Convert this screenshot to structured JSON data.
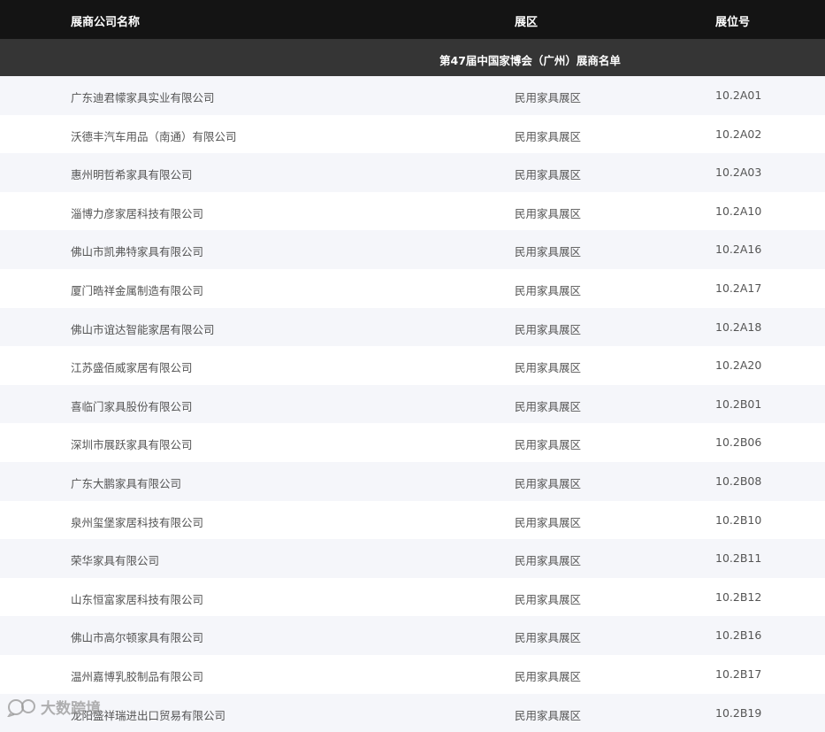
{
  "header": {
    "col_name": "展商公司名称",
    "col_zone": "展区",
    "col_booth": "展位号"
  },
  "subtitle": "第47届中国家博会（广州）展商名单",
  "rows": [
    {
      "name": "广东迪君幪家具实业有限公司",
      "zone": "民用家具展区",
      "booth": "10.2A01"
    },
    {
      "name": "沃德丰汽车用品（南通）有限公司",
      "zone": "民用家具展区",
      "booth": "10.2A02"
    },
    {
      "name": "惠州明哲希家具有限公司",
      "zone": "民用家具展区",
      "booth": "10.2A03"
    },
    {
      "name": "淄博力彦家居科技有限公司",
      "zone": "民用家具展区",
      "booth": "10.2A10"
    },
    {
      "name": "佛山市凯弗特家具有限公司",
      "zone": "民用家具展区",
      "booth": "10.2A16"
    },
    {
      "name": "厦门晧祥金属制造有限公司",
      "zone": "民用家具展区",
      "booth": "10.2A17"
    },
    {
      "name": "佛山市谊达智能家居有限公司",
      "zone": "民用家具展区",
      "booth": "10.2A18"
    },
    {
      "name": "江苏盛佰威家居有限公司",
      "zone": "民用家具展区",
      "booth": "10.2A20"
    },
    {
      "name": "喜临门家具股份有限公司",
      "zone": "民用家具展区",
      "booth": "10.2B01"
    },
    {
      "name": "深圳市展跃家具有限公司",
      "zone": "民用家具展区",
      "booth": "10.2B06"
    },
    {
      "name": "广东大鹏家具有限公司",
      "zone": "民用家具展区",
      "booth": "10.2B08"
    },
    {
      "name": "泉州玺堡家居科技有限公司",
      "zone": "民用家具展区",
      "booth": "10.2B10"
    },
    {
      "name": "荣华家具有限公司",
      "zone": "民用家具展区",
      "booth": "10.2B11"
    },
    {
      "name": "山东恒富家居科技有限公司",
      "zone": "民用家具展区",
      "booth": "10.2B12"
    },
    {
      "name": "佛山市高尔顿家具有限公司",
      "zone": "民用家具展区",
      "booth": "10.2B16"
    },
    {
      "name": "温州嘉博乳胶制品有限公司",
      "zone": "民用家具展区",
      "booth": "10.2B17"
    },
    {
      "name": "龙阳盛祥瑞进出口贸易有限公司",
      "zone": "民用家具展区",
      "booth": "10.2B19"
    }
  ],
  "watermark": {
    "text": "大数跨境",
    "icon": "chat-bubble-logo-icon"
  }
}
